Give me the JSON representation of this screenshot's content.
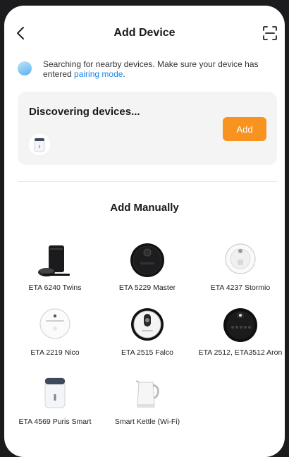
{
  "header": {
    "title": "Add Device",
    "back_icon": "chevron-left-icon",
    "scan_icon": "scan-icon"
  },
  "search": {
    "text": "Searching for nearby devices. Make sure your device has entered ",
    "link": "pairing mode",
    "suffix": "."
  },
  "discovering": {
    "title": "Discovering devices...",
    "add_label": "Add"
  },
  "manual": {
    "title": "Add Manually",
    "devices": [
      {
        "label": "ETA 6240 Twins",
        "icon": "robot-vacuum-station-icon"
      },
      {
        "label": "ETA 5229 Master",
        "icon": "robot-vacuum-black-icon"
      },
      {
        "label": "ETA 4237  Stormio",
        "icon": "robot-vacuum-white-icon"
      },
      {
        "label": "ETA 2219 Nico",
        "icon": "robot-vacuum-white-icon"
      },
      {
        "label": "ETA 2515 Falco",
        "icon": "robot-vacuum-white-icon"
      },
      {
        "label": "ETA 2512, ETA3512 Aron",
        "icon": "robot-vacuum-black-icon"
      },
      {
        "label": "ETA 4569 Puris Smart",
        "icon": "air-purifier-icon"
      },
      {
        "label": "Smart Kettle (Wi-Fi)",
        "icon": "kettle-icon"
      }
    ]
  },
  "colors": {
    "accent": "#f7931e",
    "link": "#1e88e5",
    "card_bg": "#f4f4f5"
  }
}
